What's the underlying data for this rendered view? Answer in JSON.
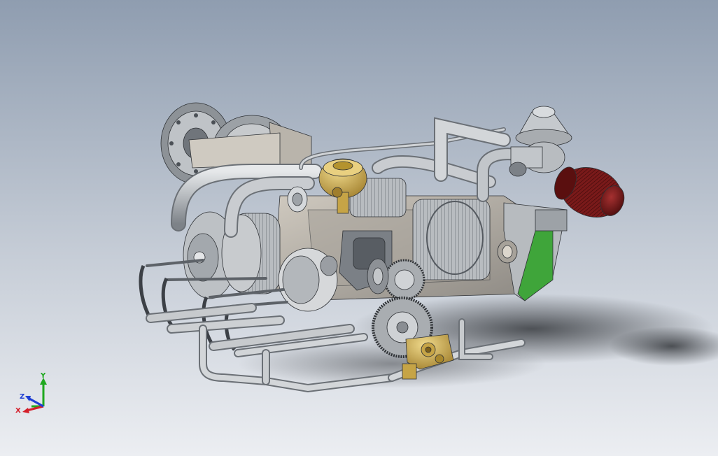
{
  "viewport": {
    "background_top": "#8f9db0",
    "background_bottom": "#eceef2",
    "model": "engine-assembly"
  },
  "triad": {
    "x_label": "X",
    "y_label": "Y",
    "z_label": "Z",
    "x_color": "#d41f2a",
    "y_color": "#1fa81f",
    "z_color": "#1f3fd4"
  },
  "colors": {
    "metal_light": "#d4d6d8",
    "metal_mid": "#a9adb1",
    "metal_dark": "#5a5f66",
    "brass": "#d7b85a",
    "air_filter": "#7a1a1a",
    "green_cover": "#3fa53a",
    "shadow": "#2c2f33"
  }
}
